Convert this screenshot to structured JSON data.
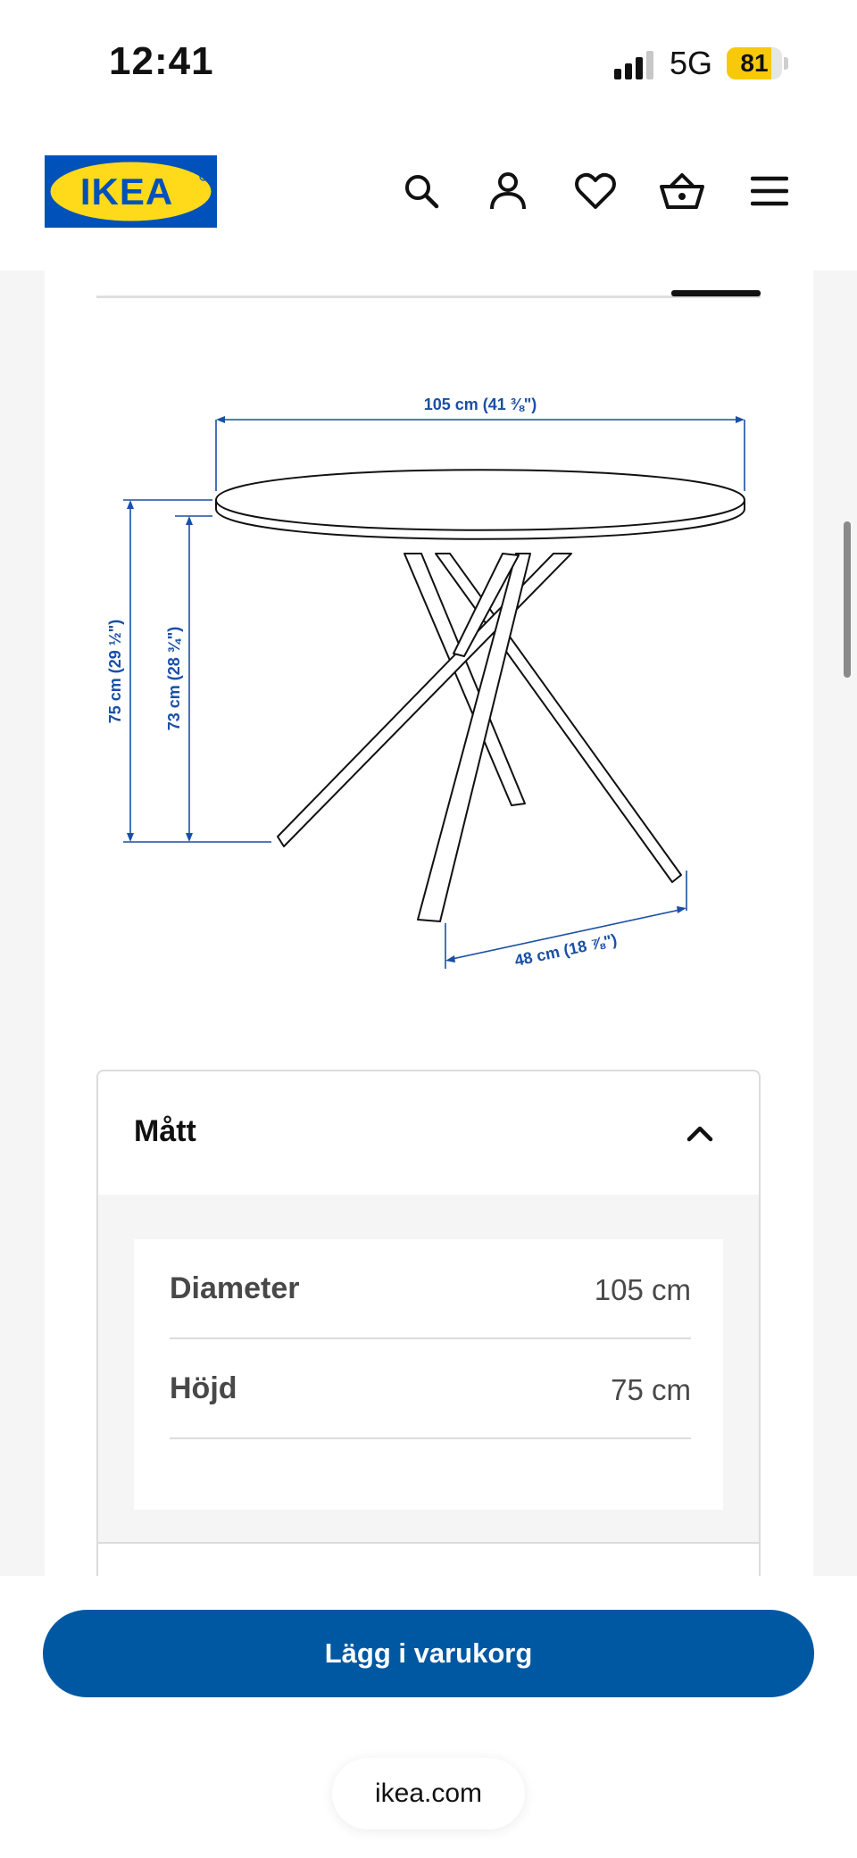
{
  "status_bar": {
    "time": "12:41",
    "network": "5G",
    "battery_percent": "81",
    "battery_level": 0.81,
    "battery_color": "#f8c90b"
  },
  "header": {
    "logo_text": "IKEA",
    "brand_blue": "#0051ba",
    "brand_yellow": "#ffda1a",
    "icons": [
      "search-icon",
      "user-icon",
      "heart-icon",
      "basket-icon",
      "menu-icon"
    ]
  },
  "diagram": {
    "width_label": "105 cm (41 ⅜\")",
    "height_label": "75 cm (29 ½\")",
    "inner_height_label": "73 cm (28 ¾\")",
    "leg_spread_label": "48 cm (18 ⅞\")",
    "dimension_color": "#1a4fa6"
  },
  "accordion": {
    "title": "Mått",
    "expanded": true,
    "specs": [
      {
        "label": "Diameter",
        "value": "105 cm"
      },
      {
        "label": "Höjd",
        "value": "75 cm"
      }
    ]
  },
  "footer": {
    "add_to_cart": "Lägg i varukorg",
    "cta_color": "#0058a3",
    "url": "ikea.com"
  }
}
